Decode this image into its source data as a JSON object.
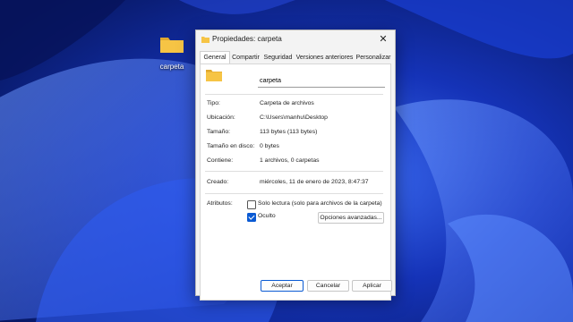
{
  "desktop": {
    "icon_label": "carpeta"
  },
  "dialog": {
    "title": "Propiedades: carpeta",
    "tabs": [
      "General",
      "Compartir",
      "Seguridad",
      "Versiones anteriores",
      "Personalizar"
    ],
    "active_tab": "General",
    "name_value": "carpeta",
    "properties": [
      {
        "label": "Tipo:",
        "value": "Carpeta de archivos"
      },
      {
        "label": "Ubicación:",
        "value": "C:\\Users\\manhu\\Desktop"
      },
      {
        "label": "Tamaño:",
        "value": "113 bytes (113 bytes)"
      },
      {
        "label": "Tamaño en disco:",
        "value": "0 bytes"
      },
      {
        "label": "Contiene:",
        "value": "1 archivos, 0 carpetas"
      },
      {
        "label": "Creado:",
        "value": "miércoles, 11 de enero de 2023, 8:47:37"
      }
    ],
    "attributes_label": "Atributos:",
    "readonly_label": "Solo lectura (solo para archivos de la carpeta)",
    "readonly_checked": false,
    "hidden_label": "Oculto",
    "hidden_checked": true,
    "advanced_button": "Opciones avanzadas...",
    "buttons": {
      "ok": "Aceptar",
      "cancel": "Cancelar",
      "apply": "Aplicar"
    }
  },
  "colors": {
    "accent": "#0a5ad3",
    "folder": "#f6c445",
    "wallpaper_dark": "#0a1f7a",
    "wallpaper_light": "#3f7bff"
  }
}
